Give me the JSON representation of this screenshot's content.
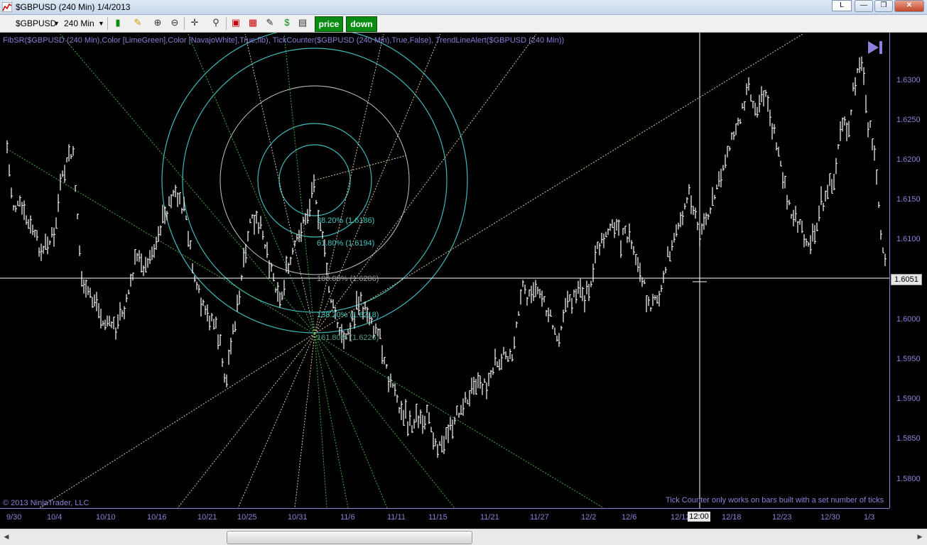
{
  "window": {
    "title": "$GBPUSD (240 Min)  1/4/2013",
    "l_button": "L"
  },
  "toolbar": {
    "instrument": "$GBPUSD",
    "interval": "240 Min",
    "price_button": "price",
    "down_button": "down"
  },
  "chart": {
    "indicators": "FibSR($GBPUSD (240 Min),Color [LimeGreen],Color [NavajoWhite],True,fib), TickCounter($GBPUSD (240 Min),True,False), TrendLineAlert($GBPUSD (240 Min))",
    "copyright": "© 2013 NinjaTrader, LLC",
    "tick_note": "Tick Counter only works on bars built with a set number of ticks",
    "current_price": "1.6051",
    "crosshair_time": "12:00",
    "price_labels": [
      "1.6300",
      "1.6250",
      "1.6200",
      "1.6150",
      "1.6100",
      "1.6050",
      "1.6000",
      "1.5950",
      "1.5900",
      "1.5850",
      "1.5800"
    ],
    "date_labels": [
      "9/30",
      "10/4",
      "10/10",
      "10/16",
      "10/21",
      "10/25",
      "10/31",
      "11/6",
      "11/11",
      "11/15",
      "11/21",
      "11/27",
      "12/2",
      "12/6",
      "12/12",
      "12/18",
      "12/23",
      "12/30",
      "1/3"
    ],
    "fib_levels": [
      "38.20% (1.6186)",
      "61.80% (1.6194)",
      "100.00% (1.6206)",
      "138.20% (1.6218)",
      "161.80% (1.6226)"
    ]
  },
  "colors": {
    "accent": "#8e80d8",
    "fib": "#45c6c0",
    "bars": "#ffffff",
    "buttons": "#0a8c12"
  }
}
